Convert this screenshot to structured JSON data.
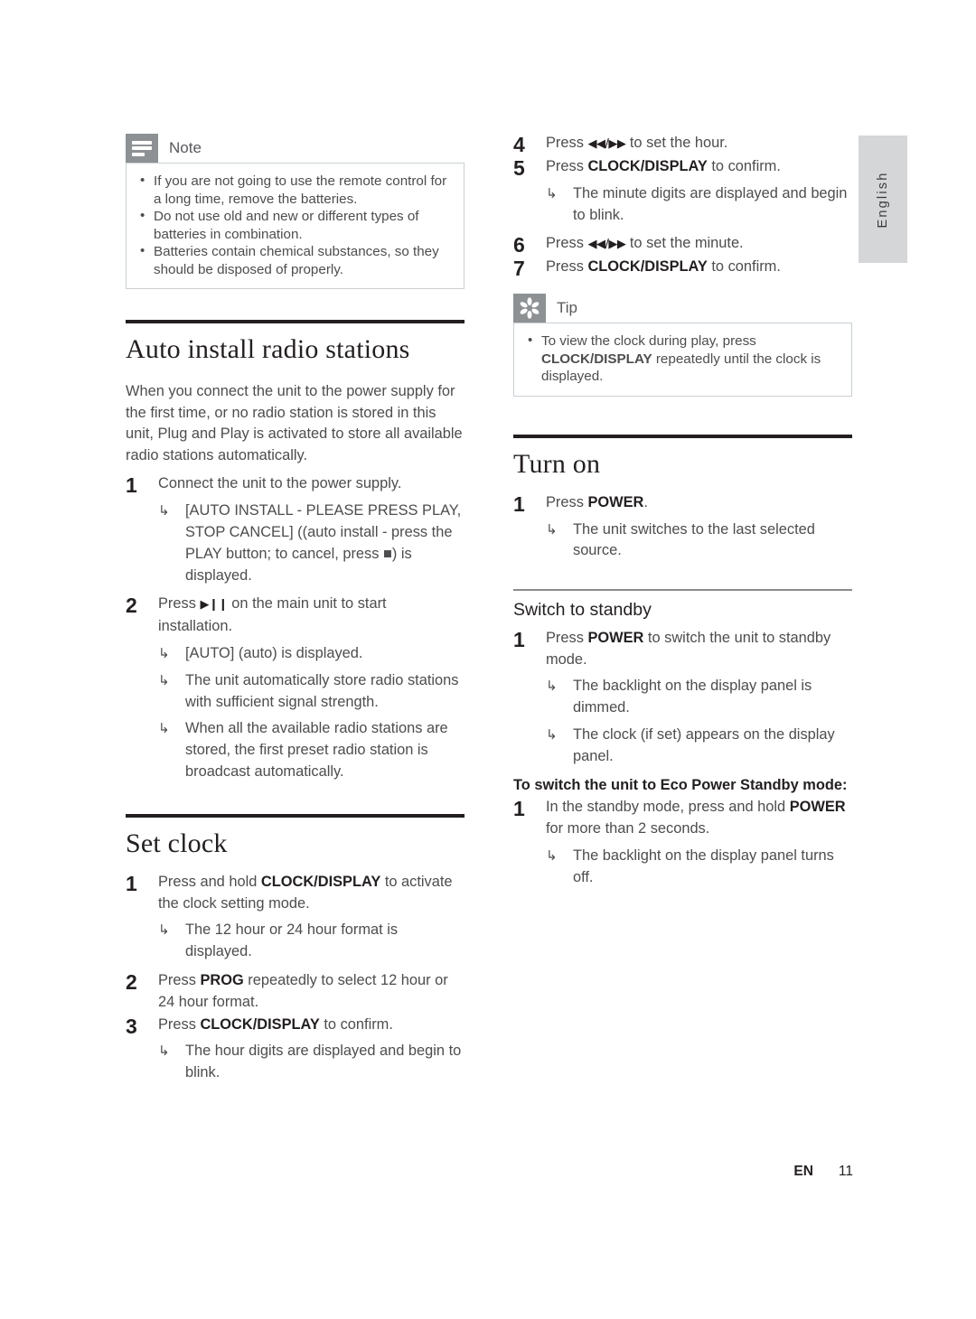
{
  "page": {
    "language_tab": "English",
    "footer": {
      "lang_code": "EN",
      "page_number": "11"
    }
  },
  "left_column": {
    "note_box": {
      "icon": "note-lines-icon",
      "title": "Note",
      "items": [
        "If you are not going to use the remote control for a long time, remove the batteries.",
        "Do not use old and new or different types of batteries in combination.",
        "Batteries contain chemical substances, so they should be disposed of properly."
      ]
    },
    "section_auto_install": {
      "heading": "Auto install radio stations",
      "intro": "When you connect the unit to the power supply for the first time, or no radio station is stored in this unit, Plug and Play is activated to store all available radio stations automatically.",
      "steps": [
        {
          "num": "1",
          "text_pre": "Connect the unit to the power supply.",
          "results": [
            "[AUTO INSTALL - PLEASE PRESS PLAY, STOP CANCEL] ((auto install - press the PLAY button; to cancel, press ■) is displayed."
          ]
        },
        {
          "num": "2",
          "text_pre": "Press ",
          "glyph": "▶❙❙",
          "text_post": " on the main unit to start installation.",
          "results": [
            "[AUTO] (auto) is displayed.",
            "The unit automatically store radio stations with sufficient signal strength.",
            "When all the available radio stations are stored, the first preset radio station is broadcast automatically."
          ]
        }
      ]
    },
    "section_set_clock": {
      "heading": "Set clock",
      "steps": [
        {
          "num": "1",
          "text_pre": "Press and hold ",
          "bold": "CLOCK/DISPLAY",
          "text_post": " to activate the clock setting mode.",
          "results": [
            "The 12 hour or 24 hour format is displayed."
          ]
        },
        {
          "num": "2",
          "text_pre": "Press ",
          "bold": "PROG",
          "text_post": " repeatedly to select 12 hour or 24 hour format.",
          "results": []
        },
        {
          "num": "3",
          "text_pre": "Press ",
          "bold": "CLOCK/DISPLAY",
          "text_post": " to confirm.",
          "results": [
            "The hour digits are displayed and begin to blink."
          ]
        }
      ]
    }
  },
  "right_column": {
    "clock_steps_continued": [
      {
        "num": "4",
        "text_pre": "Press ",
        "glyph": "◀◀/▶▶",
        "text_post": " to set the hour.",
        "results": []
      },
      {
        "num": "5",
        "text_pre": "Press ",
        "bold": "CLOCK/DISPLAY",
        "text_post": " to confirm.",
        "results": [
          "The minute digits are displayed and begin to blink."
        ]
      },
      {
        "num": "6",
        "text_pre": "Press ",
        "glyph": "◀◀/▶▶",
        "text_post": " to set the minute.",
        "results": []
      },
      {
        "num": "7",
        "text_pre": "Press ",
        "bold": "CLOCK/DISPLAY",
        "text_post": " to confirm.",
        "results": []
      }
    ],
    "tip_box": {
      "icon": "tip-asterisk-icon",
      "title": "Tip",
      "items_html": [
        {
          "pre": "To view the clock during play, press ",
          "bold": "CLOCK/DISPLAY",
          "post": " repeatedly until the clock is displayed."
        }
      ]
    },
    "section_turn_on": {
      "heading": "Turn on",
      "steps": [
        {
          "num": "1",
          "text_pre": "Press ",
          "bold": "POWER",
          "text_post": ".",
          "results": [
            "The unit switches to the last selected source."
          ]
        }
      ]
    },
    "subsection_switch_standby": {
      "heading": "Switch to standby",
      "steps": [
        {
          "num": "1",
          "text_pre": "Press ",
          "bold": "POWER",
          "text_post": " to switch the unit to standby mode.",
          "results": [
            "The backlight on the display panel is dimmed.",
            "The clock (if set) appears on the display panel."
          ]
        }
      ],
      "eco_heading": "To switch the unit to Eco Power Standby mode:",
      "eco_steps": [
        {
          "num": "1",
          "text_pre": "In the standby mode, press and hold ",
          "bold": "POWER",
          "text_post": " for more than 2 seconds.",
          "results": [
            "The backlight on the display panel turns off."
          ]
        }
      ]
    }
  },
  "symbols": {
    "result_arrow": "↳",
    "bullet": "•"
  }
}
